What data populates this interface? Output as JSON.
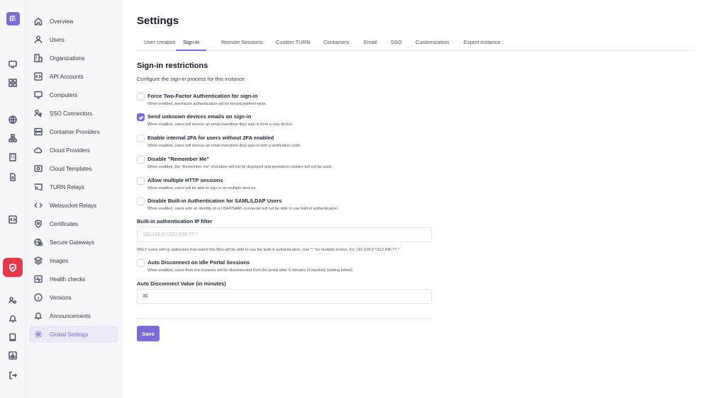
{
  "app": {
    "brand_color": "#7c6bd6",
    "danger_color": "#e23a4a"
  },
  "rail": {
    "icons": [
      "logo-icon",
      "monitor-icon",
      "apps-grid-icon",
      "globe-icon",
      "network-icon",
      "building-icon",
      "document-icon",
      "code-icon",
      "shield-icon",
      "user-settings-icon",
      "bell-icon",
      "book-icon",
      "inbox-download-icon",
      "logout-icon"
    ]
  },
  "sidebar": {
    "items": [
      {
        "label": "Overview",
        "icon": "home-icon"
      },
      {
        "label": "Users",
        "icon": "user-icon"
      },
      {
        "label": "Organizations",
        "icon": "building-icon"
      },
      {
        "label": "API Accounts",
        "icon": "api-icon"
      },
      {
        "label": "Computers",
        "icon": "monitor-icon"
      },
      {
        "label": "SSO Connectors",
        "icon": "users-key-icon"
      },
      {
        "label": "Container Providers",
        "icon": "server-icon"
      },
      {
        "label": "Cloud Providers",
        "icon": "cloud-icon"
      },
      {
        "label": "Cloud Templates",
        "icon": "image-icon"
      },
      {
        "label": "TURN Relays",
        "icon": "cast-icon"
      },
      {
        "label": "Websocket Relays",
        "icon": "code-arrows-icon"
      },
      {
        "label": "Certificates",
        "icon": "certificate-icon"
      },
      {
        "label": "Secure Gateways",
        "icon": "globe-lock-icon"
      },
      {
        "label": "Images",
        "icon": "layers-icon"
      },
      {
        "label": "Health checks",
        "icon": "activity-icon"
      },
      {
        "label": "Versions",
        "icon": "info-icon"
      },
      {
        "label": "Announcements",
        "icon": "bell-icon"
      },
      {
        "label": "Global Settings",
        "icon": "gear-icon"
      }
    ],
    "active_index": 17
  },
  "main": {
    "title": "Settings",
    "tabs": [
      {
        "label": "User creation"
      },
      {
        "label": "Sign-in"
      },
      {
        "label": "Remote Sessions"
      },
      {
        "label": "Custom TURN"
      },
      {
        "label": "Containers"
      },
      {
        "label": "Email"
      },
      {
        "label": "SSO"
      },
      {
        "label": "Customization"
      },
      {
        "label": "Export instance"
      }
    ],
    "active_tab": "Sign-in",
    "section": {
      "title": "Sign-in restrictions",
      "subtitle": "Configure the sign-in process for this instance"
    },
    "options": [
      {
        "title": "Force Two-Factor Authentication for sign-in",
        "description": "When enabled, two-factor authentication will be forced platform-wide.",
        "checked": false
      },
      {
        "title": "Send unknown devices emails on sign-in",
        "description": "When enabled, users will receive an email everytime they sign-in from a new device.",
        "checked": true
      },
      {
        "title": "Enable internal 2FA for users without 2FA enabled",
        "description": "When enabled, users will receive an email everytime they sign-in with a verification code.",
        "checked": false
      },
      {
        "title": "Disable \"Remember Me\"",
        "description": "When enabled, the \"Remember me\" checkbox will not be displayed and persistent cookies will not be used.",
        "checked": false
      },
      {
        "title": "Allow multiple HTTP sessions",
        "description": "When enabled, users will be able to sign in on multiple devices.",
        "checked": false
      },
      {
        "title": "Disable Built-in Authentication for SAML/LDAP Users",
        "description": "When enabled, users with an identity on a LDAP/SAML connector will not be able to use built-in authentication.",
        "checked": false
      }
    ],
    "ip_filter": {
      "label": "Built-in authentication IP filter",
      "value": "",
      "placeholder": "192.168.0.*;512.836.??.*",
      "help": "ONLY users with ip addresses that match this filter will be able to use the built-in authentication. Use \";\" for multiple entries. Ex: 192.168.0.*;512.836.??.*"
    },
    "auto_disconnect": {
      "title": "Auto Disconnect on Idle Portal Sessions",
      "description": "When enabled, users from this instance will be disconnected from the portal after X minutes of inactivity (setting below).",
      "checked": false
    },
    "auto_disconnect_value": {
      "label": "Auto Disconnect Value (in minutes)",
      "value": "30"
    },
    "save_label": "Save"
  }
}
